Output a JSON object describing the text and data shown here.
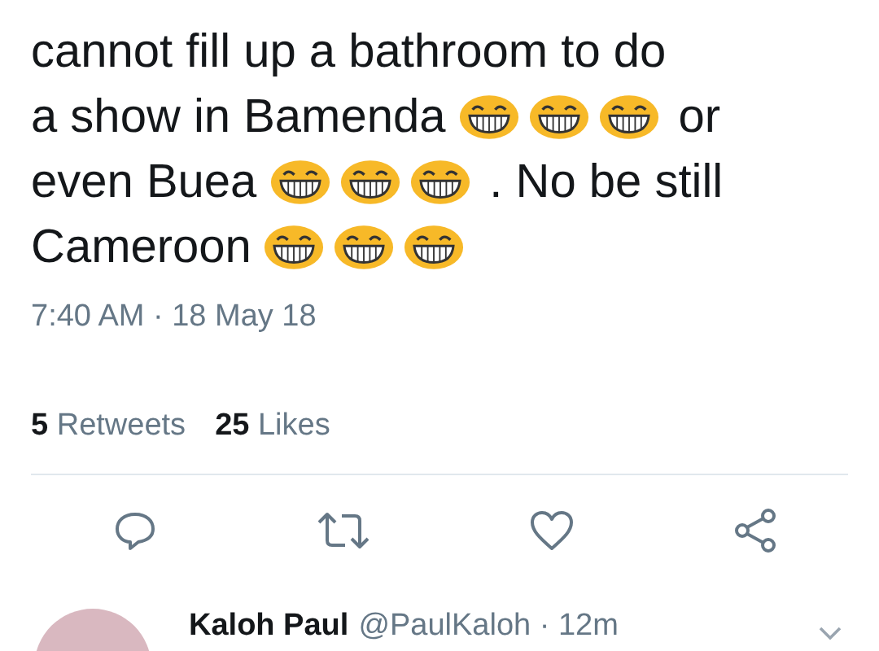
{
  "tweet": {
    "lines": [
      [
        {
          "kind": "text",
          "text": "cannot fill up a bathroom to do"
        }
      ],
      [
        {
          "kind": "text",
          "text": "a show in Bamenda"
        },
        {
          "kind": "emoji"
        },
        {
          "kind": "emoji"
        },
        {
          "kind": "emoji"
        },
        {
          "kind": "text",
          "text": "or"
        }
      ],
      [
        {
          "kind": "text",
          "text": "even Buea"
        },
        {
          "kind": "emoji"
        },
        {
          "kind": "emoji"
        },
        {
          "kind": "emoji"
        },
        {
          "kind": "text",
          "text": ". No be still"
        }
      ],
      [
        {
          "kind": "text",
          "text": "Cameroon"
        },
        {
          "kind": "emoji"
        },
        {
          "kind": "emoji"
        },
        {
          "kind": "emoji"
        }
      ]
    ],
    "timestamp": "7:40 AM · 18 May 18",
    "stats": [
      {
        "count": "5",
        "label": "Retweets"
      },
      {
        "count": "25",
        "label": "Likes"
      }
    ]
  },
  "reply": {
    "name": "Kaloh Paul",
    "handle": "@PaulKaloh · 12m"
  }
}
